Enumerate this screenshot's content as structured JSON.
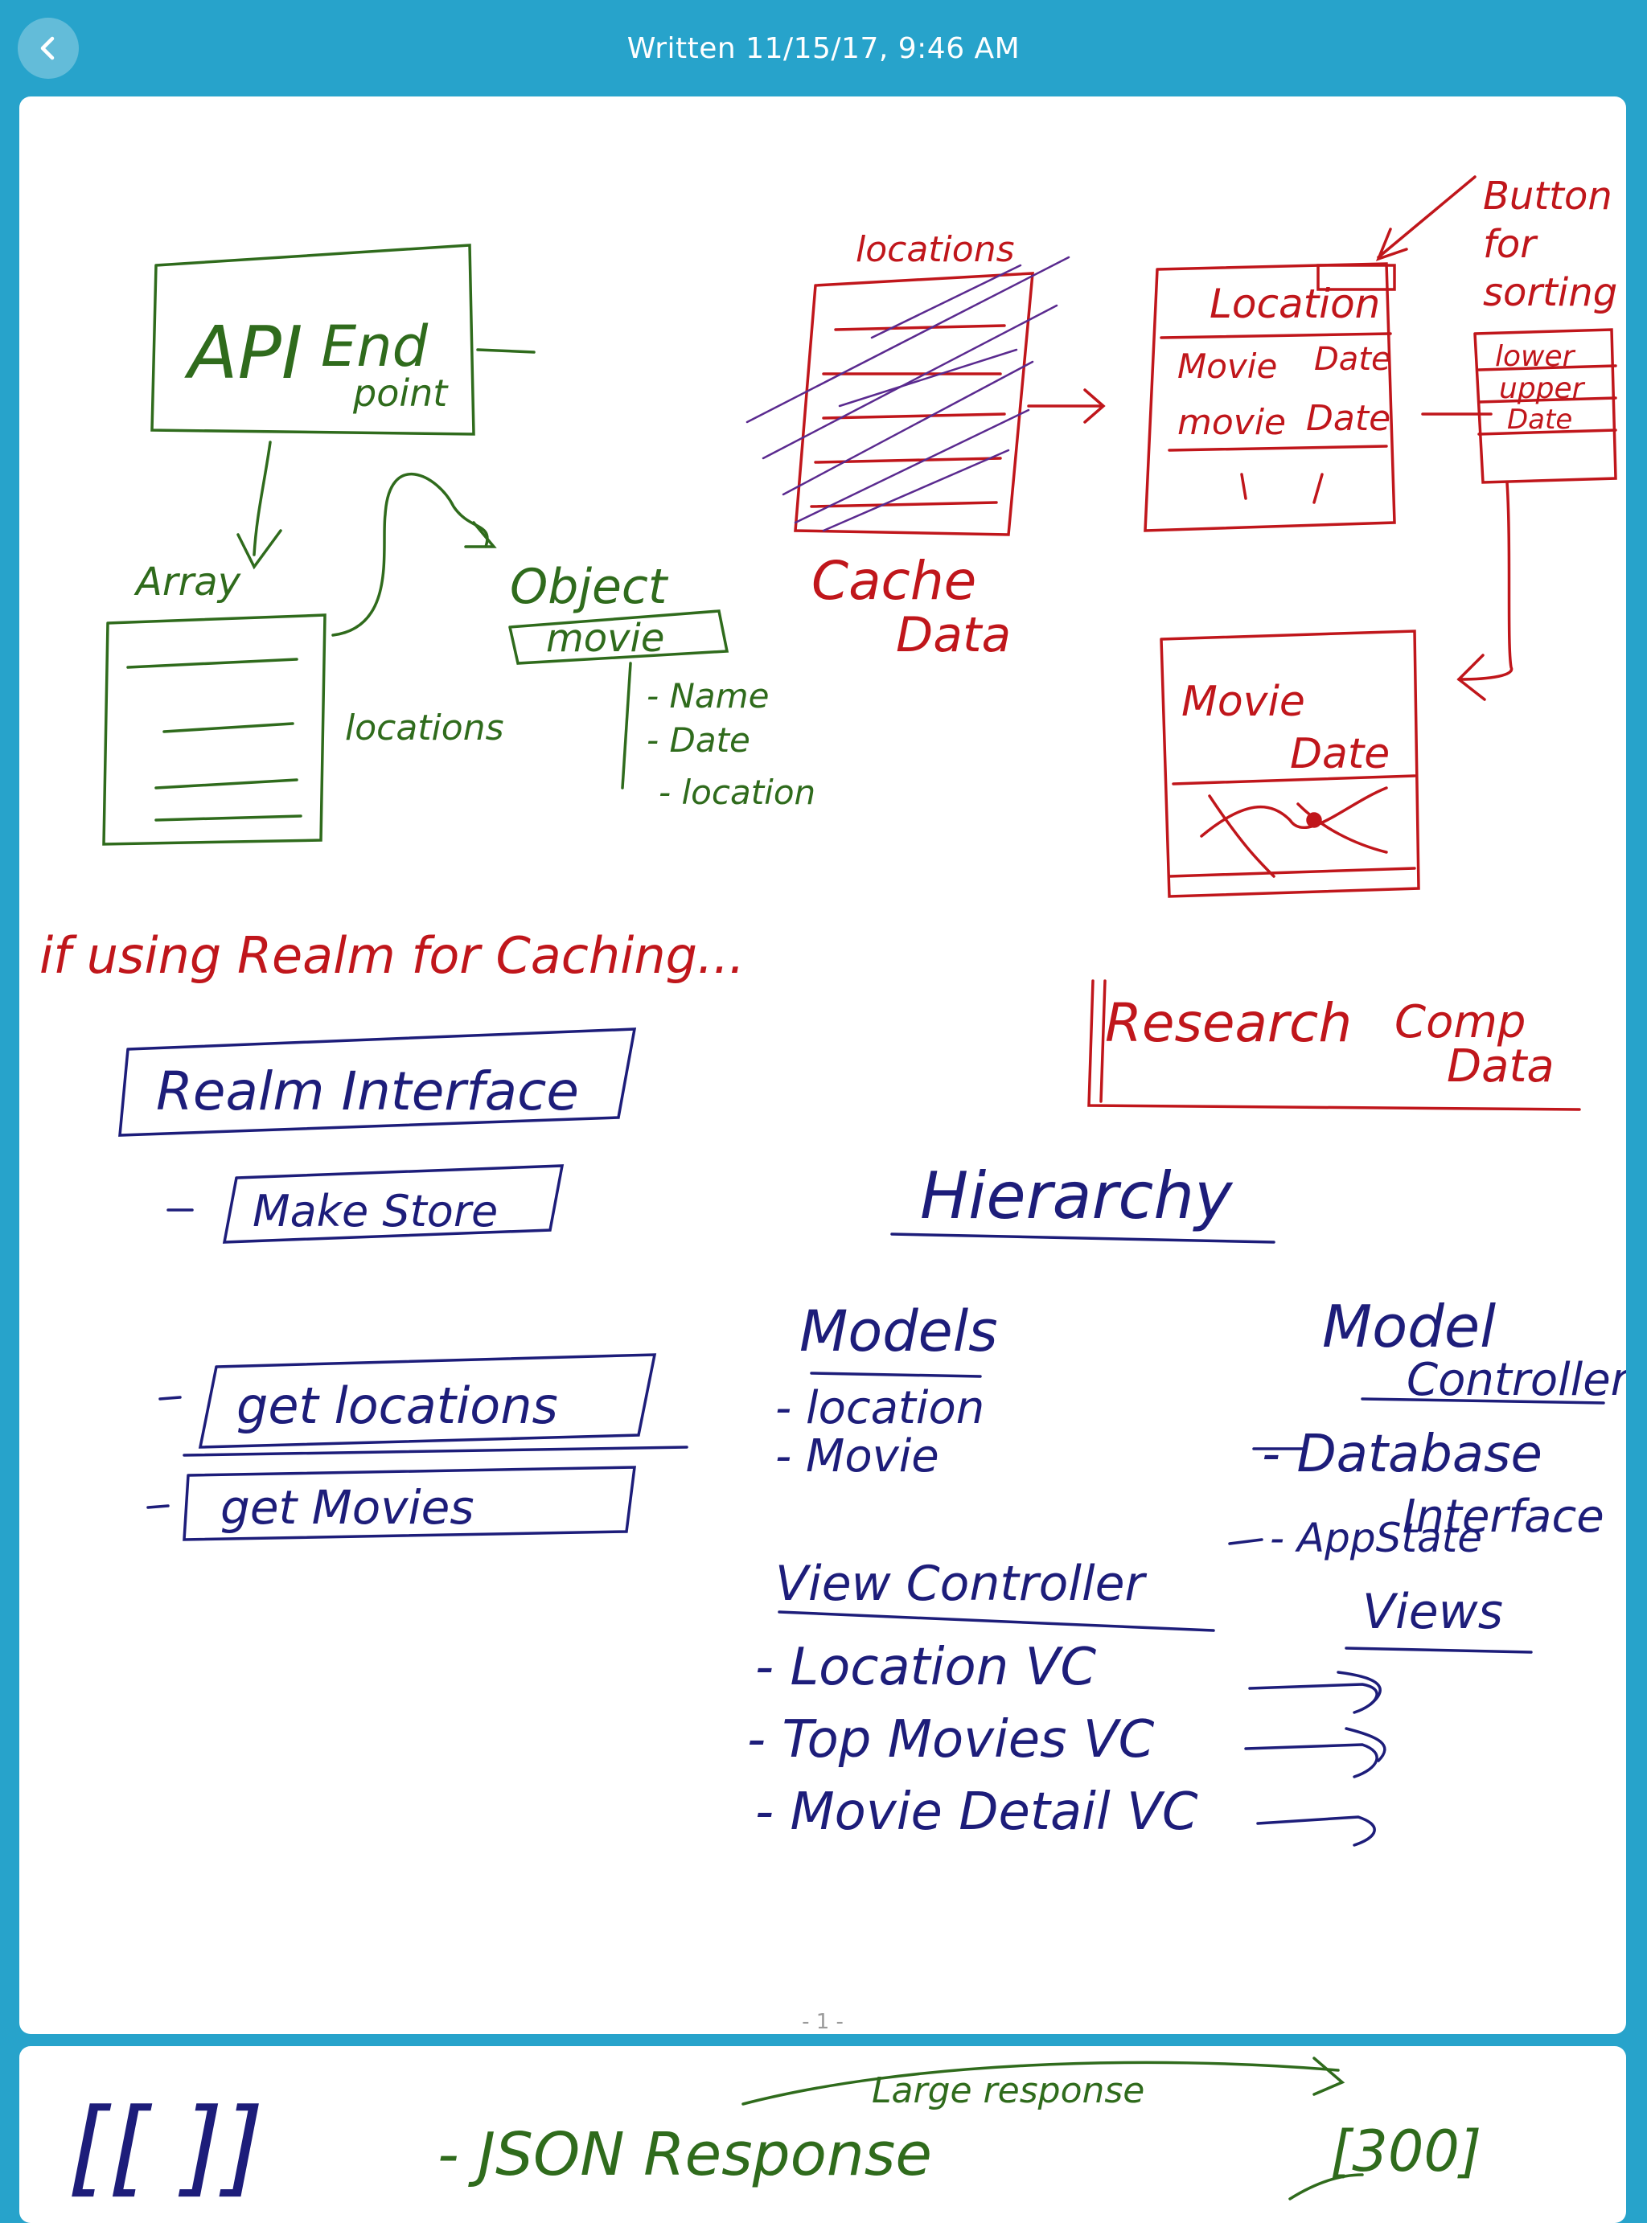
{
  "header": {
    "title": "Written 11/15/17, 9:46 AM",
    "back_icon": "chevron-left-icon"
  },
  "page1": {
    "page_number": "- 1 -",
    "green": {
      "api_endpoint_1": "API",
      "api_endpoint_2": "End",
      "api_endpoint_3": "point",
      "array": "Array",
      "locations": "locations",
      "object": "Object",
      "movie": "movie",
      "fields": [
        "- Name",
        "- Date",
        "- location"
      ]
    },
    "red": {
      "locations_header": "locations",
      "cache": "Cache",
      "data": "Data",
      "location_col": "Location",
      "movie_col": "Movie",
      "date_col": "Date",
      "movie_row": "movie",
      "date_row": "Date",
      "button_1": "Button",
      "button_2": "for",
      "button_3": "sorting",
      "sort_opts": [
        "lower",
        "upper",
        "Date"
      ],
      "movie_detail": "Movie",
      "date_detail": "Date",
      "research": "Research",
      "comp": "Comp",
      "comp_data": "Data",
      "realm_note": "if using Realm for Caching..."
    },
    "blue": {
      "realm_interface": "Realm Interface",
      "make_store": "Make Store",
      "get_locations": "get locations",
      "get_movies": "get Movies",
      "hierarchy": "Hierarchy",
      "models": "Models",
      "model_items": [
        "- location",
        "- Movie"
      ],
      "view_controller": "View Controller",
      "vc_items": [
        "- Location VC",
        "- Top Movies VC",
        "- Movie Detail VC"
      ],
      "model_controller_1": "Model",
      "model_controller_2": "Controller",
      "mc_items": [
        "- Database",
        "Interface",
        "- AppState",
        "Views"
      ]
    }
  },
  "page2": {
    "brackets": "[[ ]]",
    "json_response": "- JSON Response",
    "large_response": "Large response",
    "count": "[300]"
  },
  "colors": {
    "background": "#27a3cb",
    "green_ink": "#2f6b1c",
    "red_ink": "#c0161b",
    "blue_ink": "#1d1d7a",
    "purple_ink": "#5a2a8f"
  }
}
